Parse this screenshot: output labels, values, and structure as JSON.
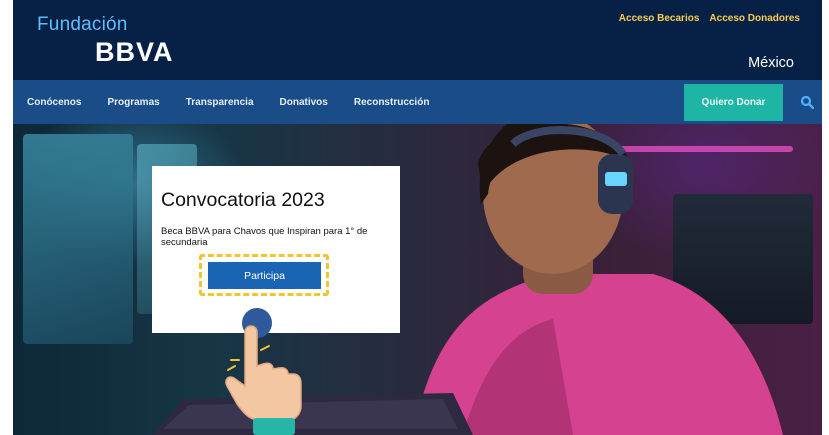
{
  "header": {
    "logo_line1": "Fundación",
    "logo_line2": "BBVA",
    "top_links": [
      "Acceso Becarios",
      "Acceso Donadores"
    ],
    "country": "México"
  },
  "nav": {
    "items": [
      "Conócenos",
      "Programas",
      "Transparencia",
      "Donativos",
      "Reconstrucción"
    ],
    "donate_label": "Quiero Donar",
    "search_icon": "search-icon"
  },
  "hero": {
    "title": "Convocatoria 2023",
    "description": "Beca BBVA para Chavos que Inspiran para 1° de secundaria",
    "cta_label": "Participa",
    "pointer_icon": "pointing-hand-icon"
  },
  "colors": {
    "header_bg": "#072146",
    "nav_bg": "#1a4c88",
    "logo_accent": "#5bbeff",
    "top_link": "#f8cd51",
    "donate_bg": "#1fb5a5",
    "cta_bg": "#1a64b4",
    "highlight": "#f2c530"
  }
}
